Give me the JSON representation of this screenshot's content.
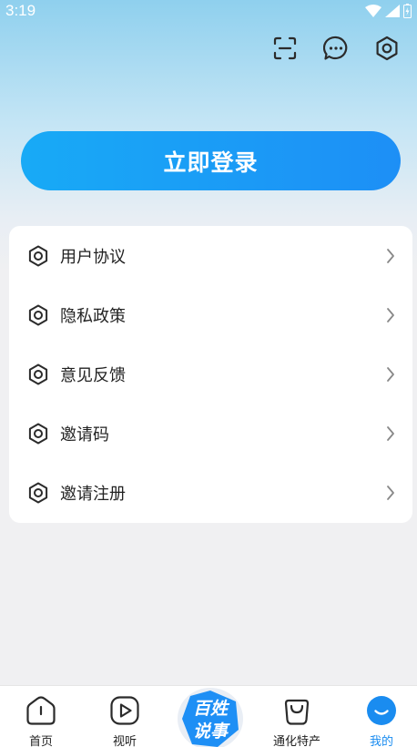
{
  "status_bar": {
    "time": "3:19"
  },
  "top_icons": [
    "scan-icon",
    "message-icon",
    "settings-icon"
  ],
  "login_button": {
    "label": "立即登录"
  },
  "menu": {
    "items": [
      {
        "label": "用户协议",
        "icon": "hexagon-icon"
      },
      {
        "label": "隐私政策",
        "icon": "hexagon-icon"
      },
      {
        "label": "意见反馈",
        "icon": "hexagon-icon"
      },
      {
        "label": "邀请码",
        "icon": "hexagon-icon"
      },
      {
        "label": "邀请注册",
        "icon": "hexagon-icon"
      }
    ]
  },
  "tabbar": {
    "tabs": [
      {
        "label": "首页",
        "icon": "home-icon",
        "active": false
      },
      {
        "label": "视听",
        "icon": "play-icon",
        "active": false
      },
      {
        "label": "",
        "icon": "center-logo",
        "active": false
      },
      {
        "label": "通化特产",
        "icon": "bag-icon",
        "active": false
      },
      {
        "label": "我的",
        "icon": "profile-icon",
        "active": true
      }
    ],
    "center_logo": {
      "line1": "百姓",
      "line2": "说事"
    }
  },
  "colors": {
    "accent": "#1a8cf0",
    "login_gradient_start": "#18aaf6",
    "login_gradient_end": "#1d8ff6",
    "hero_top": "#8fd0ee",
    "page_bg": "#f0f0f2"
  }
}
